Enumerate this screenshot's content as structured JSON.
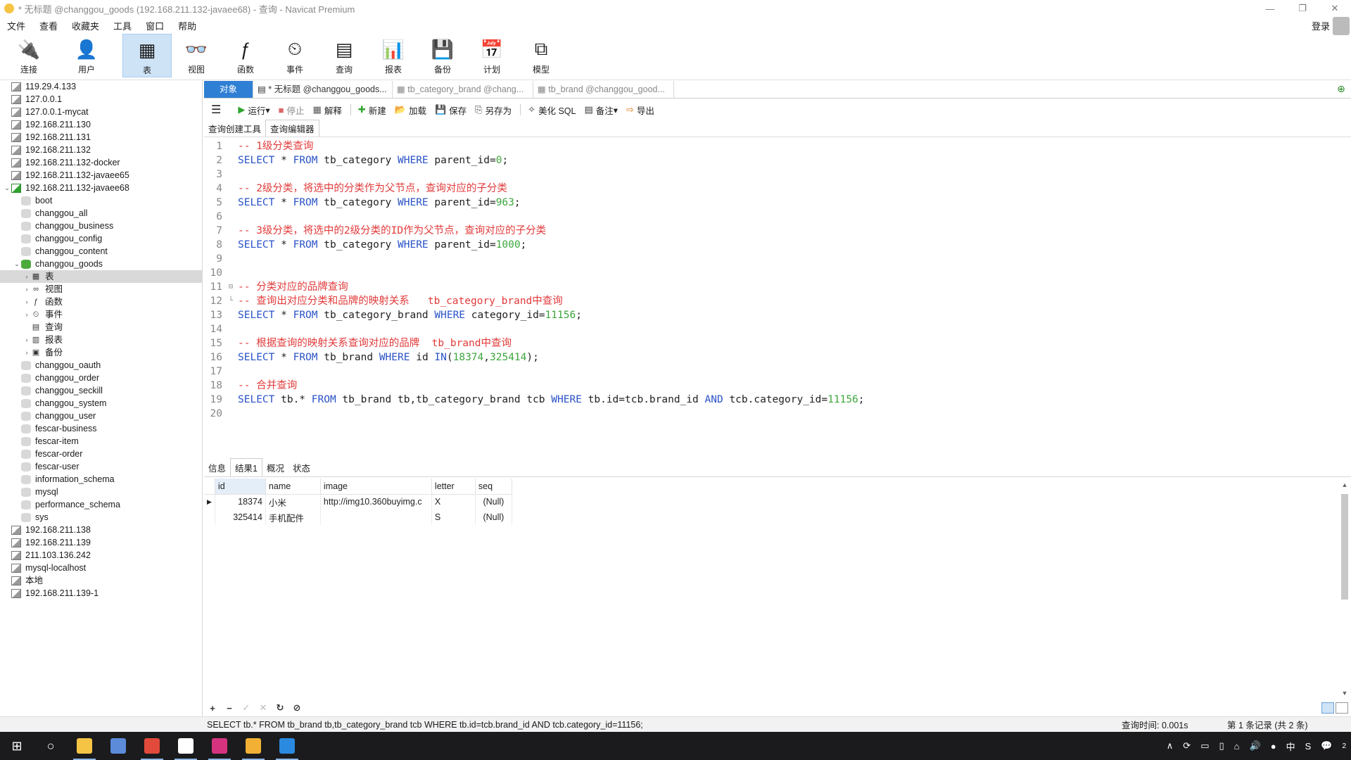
{
  "window": {
    "title": "* 无标题 @changgou_goods (192.168.211.132-javaee68) - 查询 - Navicat Premium",
    "controls": [
      "—",
      "❐",
      "✕"
    ]
  },
  "menu": {
    "items": [
      "文件",
      "查看",
      "收藏夹",
      "工具",
      "窗口",
      "帮助"
    ],
    "login": "登录"
  },
  "toolbar": {
    "buttons": [
      {
        "label": "连接",
        "icon": "plug-icon",
        "glyph": "🔌"
      },
      {
        "label": "用户",
        "icon": "user-icon",
        "glyph": "👤"
      },
      {
        "label": "表",
        "icon": "table-icon",
        "glyph": "▦"
      },
      {
        "label": "视图",
        "icon": "view-icon",
        "glyph": "👓"
      },
      {
        "label": "函数",
        "icon": "function-icon",
        "glyph": "ƒ"
      },
      {
        "label": "事件",
        "icon": "event-icon",
        "glyph": "⏲"
      },
      {
        "label": "查询",
        "icon": "query-icon",
        "glyph": "▤"
      },
      {
        "label": "报表",
        "icon": "report-icon",
        "glyph": "📊"
      },
      {
        "label": "备份",
        "icon": "backup-icon",
        "glyph": "💾"
      },
      {
        "label": "计划",
        "icon": "schedule-icon",
        "glyph": "📅"
      },
      {
        "label": "模型",
        "icon": "model-icon",
        "glyph": "⧉"
      }
    ],
    "active": "表"
  },
  "sidebar": {
    "connections_top": [
      "119.29.4.133",
      "127.0.0.1",
      "127.0.0.1-mycat",
      "192.168.211.130",
      "192.168.211.131",
      "192.168.211.132",
      "192.168.211.132-docker",
      "192.168.211.132-javaee65"
    ],
    "active_connection": "192.168.211.132-javaee68",
    "databases_before": [
      "boot",
      "changgou_all",
      "changgou_business",
      "changgou_config",
      "changgou_content"
    ],
    "active_database": "changgou_goods",
    "db_children": [
      {
        "label": "表",
        "glyph": "▦",
        "icon": "table-icon"
      },
      {
        "label": "视图",
        "glyph": "∞",
        "icon": "view-icon"
      },
      {
        "label": "函数",
        "glyph": "ƒ",
        "icon": "function-icon"
      },
      {
        "label": "事件",
        "glyph": "⏲",
        "icon": "event-icon"
      },
      {
        "label": "查询",
        "glyph": "▤",
        "icon": "query-icon"
      },
      {
        "label": "报表",
        "glyph": "▥",
        "icon": "report-icon"
      },
      {
        "label": "备份",
        "glyph": "▣",
        "icon": "backup-icon"
      }
    ],
    "databases_after": [
      "changgou_oauth",
      "changgou_order",
      "changgou_seckill",
      "changgou_system",
      "changgou_user",
      "fescar-business",
      "fescar-item",
      "fescar-order",
      "fescar-user",
      "information_schema",
      "mysql",
      "performance_schema",
      "sys"
    ],
    "connections_bottom": [
      "192.168.211.138",
      "192.168.211.139",
      "211.103.136.242",
      "mysql-localhost",
      "本地",
      "192.168.211.139-1"
    ]
  },
  "tabs": {
    "object": "对象",
    "items": [
      "* 无标题 @changgou_goods...",
      "tb_category_brand @chang...",
      "tb_brand @changgou_good..."
    ]
  },
  "query_toolbar": {
    "menu_glyph": "☰",
    "buttons": [
      {
        "label": "运行",
        "glyph": "▶",
        "color": "#2ea42e",
        "disabled": false,
        "dropdown": true
      },
      {
        "label": "停止",
        "glyph": "■",
        "color": "#d66",
        "disabled": true,
        "dropdown": false
      },
      {
        "label": "解释",
        "glyph": "▦",
        "color": "#555",
        "disabled": false,
        "dropdown": false
      },
      {
        "label": "新建",
        "glyph": "✚",
        "color": "#2ea42e",
        "disabled": false,
        "dropdown": false
      },
      {
        "label": "加载",
        "glyph": "📂",
        "color": "#d9a11a",
        "disabled": false,
        "dropdown": false
      },
      {
        "label": "保存",
        "glyph": "💾",
        "color": "#333",
        "disabled": false,
        "dropdown": false
      },
      {
        "label": "另存为",
        "glyph": "⎘",
        "color": "#333",
        "disabled": false,
        "dropdown": false
      },
      {
        "label": "美化 SQL",
        "glyph": "✧",
        "color": "#333",
        "disabled": false,
        "dropdown": false
      },
      {
        "label": "备注",
        "glyph": "▤",
        "color": "#333",
        "disabled": false,
        "dropdown": true
      },
      {
        "label": "导出",
        "glyph": "⇨",
        "color": "#e07b1a",
        "disabled": false,
        "dropdown": false
      }
    ]
  },
  "editor_tabs": [
    "查询创建工具",
    "查询编辑器"
  ],
  "editor": {
    "lines": [
      [
        {
          "t": "cm",
          "v": "-- 1级分类查询"
        }
      ],
      [
        {
          "t": "kw",
          "v": "SELECT"
        },
        {
          "t": "id",
          "v": " * "
        },
        {
          "t": "kw",
          "v": "FROM"
        },
        {
          "t": "id",
          "v": " tb_category "
        },
        {
          "t": "kw",
          "v": "WHERE"
        },
        {
          "t": "id",
          "v": " parent_id="
        },
        {
          "t": "num",
          "v": "0"
        },
        {
          "t": "id",
          "v": ";"
        }
      ],
      [],
      [
        {
          "t": "cm",
          "v": "-- 2级分类，将选中的分类作为父节点，查询对应的子分类"
        }
      ],
      [
        {
          "t": "kw",
          "v": "SELECT"
        },
        {
          "t": "id",
          "v": " * "
        },
        {
          "t": "kw",
          "v": "FROM"
        },
        {
          "t": "id",
          "v": " tb_category "
        },
        {
          "t": "kw",
          "v": "WHERE"
        },
        {
          "t": "id",
          "v": " parent_id="
        },
        {
          "t": "num",
          "v": "963"
        },
        {
          "t": "id",
          "v": ";"
        }
      ],
      [],
      [
        {
          "t": "cm",
          "v": "-- 3级分类，将选中的2级分类的ID作为父节点，查询对应的子分类"
        }
      ],
      [
        {
          "t": "kw",
          "v": "SELECT"
        },
        {
          "t": "id",
          "v": " * "
        },
        {
          "t": "kw",
          "v": "FROM"
        },
        {
          "t": "id",
          "v": " tb_category "
        },
        {
          "t": "kw",
          "v": "WHERE"
        },
        {
          "t": "id",
          "v": " parent_id="
        },
        {
          "t": "num",
          "v": "1000"
        },
        {
          "t": "id",
          "v": ";"
        }
      ],
      [],
      [],
      [
        {
          "t": "cm",
          "v": "-- 分类对应的品牌查询"
        }
      ],
      [
        {
          "t": "cm",
          "v": "-- 查询出对应分类和品牌的映射关系   tb_category_brand中查询"
        }
      ],
      [
        {
          "t": "kw",
          "v": "SELECT"
        },
        {
          "t": "id",
          "v": " * "
        },
        {
          "t": "kw",
          "v": "FROM"
        },
        {
          "t": "id",
          "v": " tb_category_brand "
        },
        {
          "t": "kw",
          "v": "WHERE"
        },
        {
          "t": "id",
          "v": " category_id="
        },
        {
          "t": "num",
          "v": "11156"
        },
        {
          "t": "id",
          "v": ";"
        }
      ],
      [],
      [
        {
          "t": "cm",
          "v": "-- 根据查询的映射关系查询对应的品牌  tb_brand中查询"
        }
      ],
      [
        {
          "t": "kw",
          "v": "SELECT"
        },
        {
          "t": "id",
          "v": " * "
        },
        {
          "t": "kw",
          "v": "FROM"
        },
        {
          "t": "id",
          "v": " tb_brand "
        },
        {
          "t": "kw",
          "v": "WHERE"
        },
        {
          "t": "id",
          "v": " id "
        },
        {
          "t": "kw",
          "v": "IN"
        },
        {
          "t": "id",
          "v": "("
        },
        {
          "t": "num",
          "v": "18374"
        },
        {
          "t": "id",
          "v": ","
        },
        {
          "t": "num",
          "v": "325414"
        },
        {
          "t": "id",
          "v": ");"
        }
      ],
      [],
      [
        {
          "t": "cm",
          "v": "-- 合并查询"
        }
      ],
      [
        {
          "t": "kw",
          "v": "SELECT"
        },
        {
          "t": "id",
          "v": " tb.* "
        },
        {
          "t": "kw",
          "v": "FROM"
        },
        {
          "t": "id",
          "v": " tb_brand tb,tb_category_brand tcb "
        },
        {
          "t": "kw",
          "v": "WHERE"
        },
        {
          "t": "id",
          "v": " tb.id=tcb.brand_id "
        },
        {
          "t": "kw",
          "v": "AND"
        },
        {
          "t": "id",
          "v": " tcb.category_id="
        },
        {
          "t": "num",
          "v": "11156"
        },
        {
          "t": "id",
          "v": ";"
        }
      ],
      []
    ],
    "fold_lines": [
      11,
      12
    ]
  },
  "result_tabs": [
    "信息",
    "结果1",
    "概况",
    "状态"
  ],
  "active_result_tab": "结果1",
  "results": {
    "columns": [
      "id",
      "name",
      "image",
      "letter",
      "seq"
    ],
    "rows": [
      [
        "18374",
        "小米",
        "http://img10.360buyimg.c",
        "X",
        "(Null)"
      ],
      [
        "325414",
        "手机配件",
        "",
        "S",
        "(Null)"
      ]
    ]
  },
  "grid_nav": [
    "+",
    "−",
    "✓",
    "✕",
    "↻",
    "⊘"
  ],
  "status": {
    "sql": "SELECT tb.* FROM tb_brand tb,tb_category_brand tcb WHERE tb.id=tcb.brand_id AND tcb.category_id=11156;",
    "query_time": "查询时间: 0.001s",
    "records": "第 1 条记录 (共 2 条)"
  },
  "taskbar": {
    "start": "⊞",
    "search": "○",
    "apps": [
      {
        "icon": "navicat-icon",
        "color": "#f6c444"
      },
      {
        "icon": "screenshot-icon",
        "color": "#5b8bd9"
      },
      {
        "icon": "chrome-icon",
        "color": "#e24a3b"
      },
      {
        "icon": "typora-icon",
        "color": "#ffffff"
      },
      {
        "icon": "intellij-icon",
        "color": "#d6337f"
      },
      {
        "icon": "dbeaver-icon",
        "color": "#f2b035"
      },
      {
        "icon": "vscode-icon",
        "color": "#2a8ae0"
      }
    ],
    "tray": [
      "∧",
      "⟳",
      "▭",
      "▯",
      "⌂",
      "🔊",
      "●",
      "中",
      "S",
      "💬"
    ],
    "notification_count": "2"
  }
}
